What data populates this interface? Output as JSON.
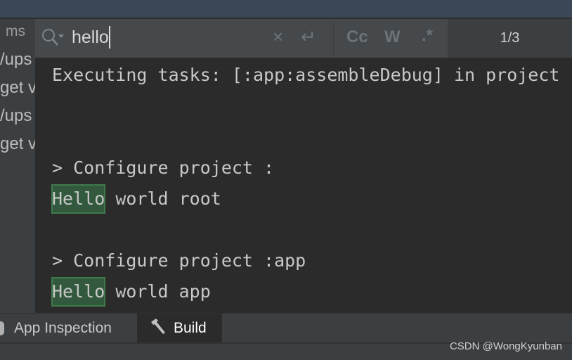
{
  "left_panel": {
    "lines": [
      "ms",
      "/ups",
      "get v",
      "/ups",
      "get v"
    ]
  },
  "search": {
    "query": "hello",
    "icons": [
      "search-icon",
      "clear-icon",
      "newline-icon",
      "match-case-icon",
      "words-icon",
      "regex-icon"
    ],
    "match_case_label": "Cc",
    "words_label": "W",
    "regex_label": ".*",
    "counter": "1/3"
  },
  "console": {
    "lines": [
      "Executing tasks: [:app:assembleDebug] in project",
      "> Configure project :",
      "world root",
      "> Configure project :app",
      "world app"
    ],
    "highlight": "Hello",
    "highlight_color": "#32593d"
  },
  "tabs": [
    {
      "label": "App Inspection"
    },
    {
      "label": "Build",
      "active": true
    }
  ],
  "watermark": "CSDN @WongKyunban"
}
